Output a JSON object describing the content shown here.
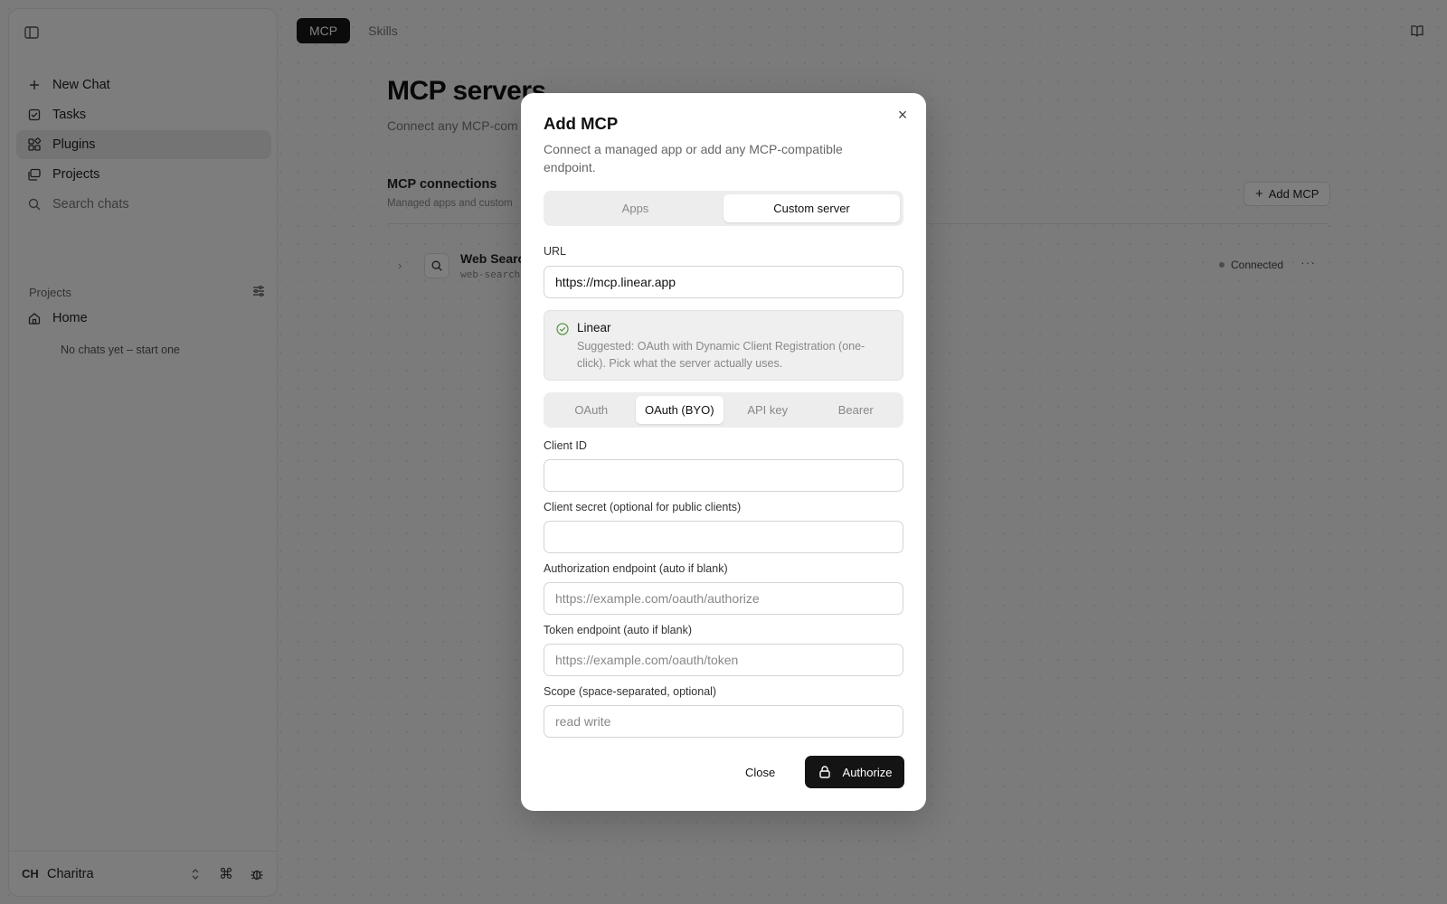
{
  "sidebar": {
    "items": [
      {
        "label": "New Chat",
        "icon": "plus-icon"
      },
      {
        "label": "Tasks",
        "icon": "checkbox-icon"
      },
      {
        "label": "Plugins",
        "icon": "plugins-icon"
      },
      {
        "label": "Projects",
        "icon": "projects-icon"
      },
      {
        "label": "Search chats",
        "icon": "search-icon"
      }
    ],
    "projects_heading": "Projects",
    "home_label": "Home",
    "empty_text": "No chats yet – start one",
    "user": {
      "initials": "CH",
      "name": "Charitra"
    }
  },
  "top_tabs": [
    {
      "label": "MCP",
      "active": true
    },
    {
      "label": "Skills",
      "active": false
    }
  ],
  "main": {
    "title": "MCP servers",
    "subtitle": "Connect any MCP-com",
    "connections_title": "MCP connections",
    "connections_sub": "Managed apps and custom",
    "add_button": "Add MCP",
    "row": {
      "name": "Web Searc",
      "slug": "web-search",
      "status": "Connected"
    }
  },
  "modal": {
    "title": "Add MCP",
    "description": "Connect a managed app or add any MCP-compatible endpoint.",
    "type_tabs": [
      {
        "label": "Apps",
        "active": false
      },
      {
        "label": "Custom server",
        "active": true
      }
    ],
    "url_label": "URL",
    "url_value": "https://mcp.linear.app",
    "suggestion": {
      "name": "Linear",
      "text": "Suggested: OAuth with Dynamic Client Registration (one-click). Pick what the server actually uses."
    },
    "auth_tabs": [
      {
        "label": "OAuth",
        "active": false
      },
      {
        "label": "OAuth (BYO)",
        "active": true
      },
      {
        "label": "API key",
        "active": false
      },
      {
        "label": "Bearer",
        "active": false
      }
    ],
    "fields": [
      {
        "label": "Client ID",
        "value": "",
        "placeholder": ""
      },
      {
        "label": "Client secret (optional for public clients)",
        "value": "",
        "placeholder": ""
      },
      {
        "label": "Authorization endpoint (auto if blank)",
        "value": "",
        "placeholder": "https://example.com/oauth/authorize"
      },
      {
        "label": "Token endpoint (auto if blank)",
        "value": "",
        "placeholder": "https://example.com/oauth/token"
      },
      {
        "label": "Scope (space-separated, optional)",
        "value": "",
        "placeholder": "read write"
      }
    ],
    "close_label": "Close",
    "authorize_label": "Authorize"
  },
  "colors": {
    "accent": "#141414",
    "overlay": "rgba(0,0,0,0.5)",
    "success": "#5a9a4a"
  }
}
